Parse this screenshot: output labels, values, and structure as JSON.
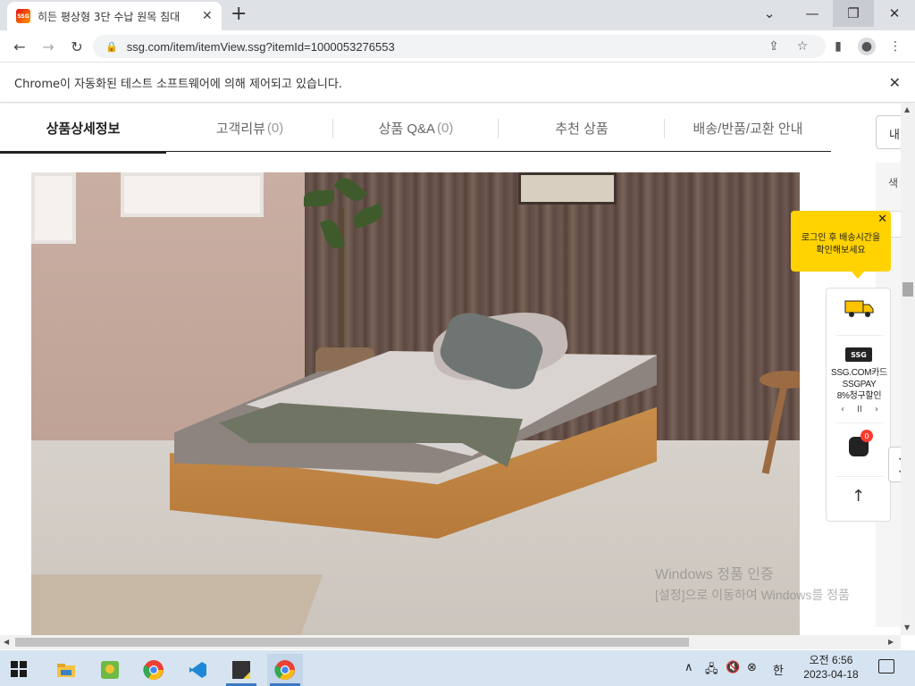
{
  "browser": {
    "tab_title": "히든 평상형 3단 수납 원목 침대",
    "favicon_text": "SSG",
    "url": "ssg.com/item/itemView.ssg?itemId=1000053276553",
    "infobar_text": "Chrome이 자동화된 테스트 소프트웨어에 의해 제어되고 있습니다."
  },
  "detail_tabs": [
    {
      "label": "상품상세정보",
      "count": ""
    },
    {
      "label": "고객리뷰",
      "count": "(0)"
    },
    {
      "label": "상품 Q&A",
      "count": "(0)"
    },
    {
      "label": "추천 상품",
      "count": ""
    },
    {
      "label": "배송/반품/교환 안내",
      "count": ""
    }
  ],
  "side": {
    "select_label": "내",
    "color_label": "색"
  },
  "tooltip": {
    "line1": "로그인 후 배송시간을",
    "line2": "확인해보세요"
  },
  "quick_menu": {
    "ssg_badge": "SSG",
    "promo_line1": "SSG.COM카드",
    "promo_line2": "SSGPAY",
    "promo_line3": "8%청구할인",
    "cart_count": "0"
  },
  "watermark": {
    "line1": "Windows 정품 인증",
    "line2": "[설정]으로 이동하여 Windows를 정품"
  },
  "taskbar": {
    "time": "오전 6:56",
    "date": "2023-04-18",
    "ime": "한"
  },
  "colors": {
    "accent_yellow": "#ffd200",
    "taskbar_bg": "#d6e4f1",
    "active_tab_underline": "#222222"
  }
}
